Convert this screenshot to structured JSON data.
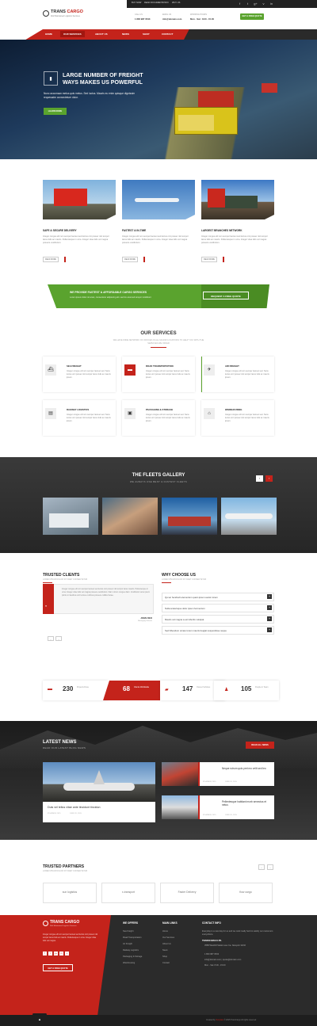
{
  "topbar": {
    "links": [
      "BUY NOW",
      "READ DOCUMENTATION",
      "WHY US"
    ],
    "social": [
      "f",
      "t",
      "g+",
      "v",
      "in"
    ]
  },
  "header": {
    "logo": {
      "brand_a": "TRANS",
      "brand_b": "CARGO",
      "tagline": "Well Maintained Logistics Services"
    },
    "call": {
      "label": "CALL US",
      "value": "1 800 987 0543"
    },
    "email": {
      "label": "EMAIL US",
      "value": "info@domain.com"
    },
    "hours": {
      "label": "WORKING HOURS",
      "value": "Mon - Sat : 8.00 - 15.00"
    },
    "quote_button": "GET A FREE QUOTE"
  },
  "nav": {
    "items": [
      "HOME",
      "OUR SERVICES",
      "ABOUT US",
      "NEWS",
      "SHOP",
      "CONTACT"
    ]
  },
  "hero": {
    "title": "LARGE NUMBER OF FREIGHT WAYS MAKES US POWERFUL",
    "text": "Nunc accumsan metus quis metus. Sed luctus. Mauris eu enim quisque dignissim requesadm consectetuer dolor.",
    "button": "LEARN MORE"
  },
  "features": [
    {
      "title": "SAFE & SECURE DELIVERY",
      "text": "Integer congue elit non semper laoreet sed lectus orci posuer nisl tempor lacus felis ac mauris. Pellentesque in urna. Integer vitae felis vel magna posuere vestibulum.",
      "button": "READ MORE"
    },
    {
      "title": "FASTEST & IN-TIME",
      "text": "Integer congue elit non semper laoreet sed lectus orci posuer nisl tempor lacus felis ac mauris. Pellentesque in urna. Integer vitae felis vel magna posuere vestibulum.",
      "button": "READ MORE"
    },
    {
      "title": "LARGEST BRANCHES NETWORK",
      "text": "Integer congue elit non semper laoreet sed lectus orci posuer nisl tempor lacus felis ac mauris. Pellentesque in urna. Integer vitae felis vel magna posuere vestibulum.",
      "button": "READ MORE"
    }
  ],
  "band": {
    "title": "WE PROVIDE FASTEST & AFFORDABLE CARGO SERVICES",
    "text": "Lorem ipsum dolor sit amet, consectetur adipiscing elit. sed do eiusmod tempor incididunt",
    "button": "REQUEST A FREE QUOTE"
  },
  "services": {
    "title": "OUR SERVICES",
    "subtitle": "WE HAVE WIDE NETWORK OF OFFICES IN ALL MAJOR LOCATIONS TO HELP YOU WITH THE SERVICES WE OFFER",
    "items": [
      {
        "title": "SEA FREIGHT",
        "text": "Integer congue elit non semper laoreet sed. Sans lectus orci posuer nisl tempor lacus felis ac mauris ipsum."
      },
      {
        "title": "ROAD TRANSPORTATION",
        "text": "Integer congue elit non semper laoreet sed. Sans lectus orci posuer nisl tempor lacus felis ac mauris ipsum."
      },
      {
        "title": "AIR FREIGHT",
        "text": "Integer congue elit non semper laoreet sed. Sans lectus orci posuer nisl tempor lacus felis ac mauris ipsum."
      },
      {
        "title": "RAILWAY LOGISTICS",
        "text": "Integer congue elit non semper laoreet sed. Sans lectus orci posuer nisl tempor lacus felis ac mauris ipsum."
      },
      {
        "title": "PACKAGING & STORAGE",
        "text": "Integer congue elit non semper laoreet sed. Sans lectus orci posuer nisl tempor lacus felis ac mauris ipsum."
      },
      {
        "title": "WAREHOUSING",
        "text": "Integer congue elit non semper laoreet sed. Sans lectus orci posuer nisl tempor lacus felis ac mauris ipsum."
      }
    ]
  },
  "fleet": {
    "title": "THE FLEETS GALLERY",
    "subtitle": "WE ALWAYS USE BEST & FASTEST FLEETS"
  },
  "clients": {
    "title": "TRUSTED CLIENTS",
    "subtitle": "LOREM IPSUM DOLOR SIT AMET CONSECTETUR",
    "quote": "Integer congue elit non semper laoreet sed lectus orci posuer nisl tempor lacus mauris. Pellentesque in urna. Integer vitae felis vel magna posuere vestibulum. Nam rutrum congue diam. Vestibulum ante ipsum primis in faucibus orci luctus et ultrices posuere cubilia Curae.",
    "name": "JOHN DEO",
    "role": "Managing Director"
  },
  "why": {
    "title": "WHY CHOOSE US",
    "subtitle": "LOREM IPSUM DOLOR SIT AMET CONSECTETUR",
    "items": [
      "Qui ac hendrerit elementum quam ipsum auctor lorem",
      "Nulla scelerisque dolor ipsum fermentum",
      "Mauris vel magna a est lobortis volutpat",
      "Sed bibendum ornare lorem mauris feugiat suspendisse neque"
    ]
  },
  "stats": [
    {
      "number": "230",
      "label": "Projects Done"
    },
    {
      "number": "68",
      "label": "Clients Worldwide"
    },
    {
      "number": "147",
      "label": "Owned Vehicles"
    },
    {
      "number": "105",
      "label": "People in Team"
    }
  ],
  "news": {
    "title": "LATEST NEWS",
    "subtitle": "READ OUR LATEST BLOG NEWS",
    "button": "READ ALL NEWS",
    "big": {
      "title": "Duis vel tellus vitae ante tincidunt tincidun",
      "author": "BY ADMIN, 2015",
      "date": "JUNE 20, 2015"
    },
    "small": [
      {
        "title": "Neque rutrum quis pret mo velit sed leo",
        "author": "BY ADMIN, 2015",
        "date": "JUNE 20, 2015"
      },
      {
        "title": "Pellentesque habitant morb senectus et netus",
        "author": "BY ADMIN, 2015",
        "date": "JUNE 20, 2015"
      }
    ]
  },
  "partners": {
    "title": "TRUSTED PARTNERS",
    "subtitle": "LOREM IPSUM DOLOR SIT AMET CONSECTETUR",
    "logos": [
      "sun logistics",
      "x-transport",
      "Faster Delivery",
      "flow cargo"
    ]
  },
  "footer": {
    "brand_a": "TRANS",
    "brand_b": "CARGO",
    "tagline": "Well Maintained Logistics Services",
    "text": "Integer congue elit non semper laoreet sed lectus orci posuer nisl tempor lacus felis ac mauris. Pellentesque in urna. Integer vitae felis vel magna.",
    "button": "GET A FREE QUOTE",
    "social": [
      "f",
      "t",
      "g+",
      "in",
      "v"
    ],
    "offers_title": "WE OFFERS",
    "offers": [
      "Sea Freight",
      "Road Transportation",
      "Air Freight",
      "Railway Logistics",
      "Packaging & Storage",
      "Warehousing"
    ],
    "links_title": "MAIN LINKS",
    "links": [
      "Home",
      "Our Services",
      "About Us",
      "News",
      "Shop",
      "Contact"
    ],
    "contact_title": "CONTACT INFO",
    "contact_text": "Everyday is a new day for us and we work really hard to satisfy our customers everywhere.",
    "company": "TRANSCARGO LTD.",
    "address": "3558 Westhill Station ave Ca. Newyork 32/32",
    "phone": "1 800 987 0543",
    "email": "info@domain.com  |  quote@domain.com",
    "hours": "Mon - Sat: 8.00 - 15.00",
    "copyright_pre": "Created by",
    "copyright_by": "Template",
    "copyright_post": "© 2015 TransCargo All rights reserved"
  }
}
